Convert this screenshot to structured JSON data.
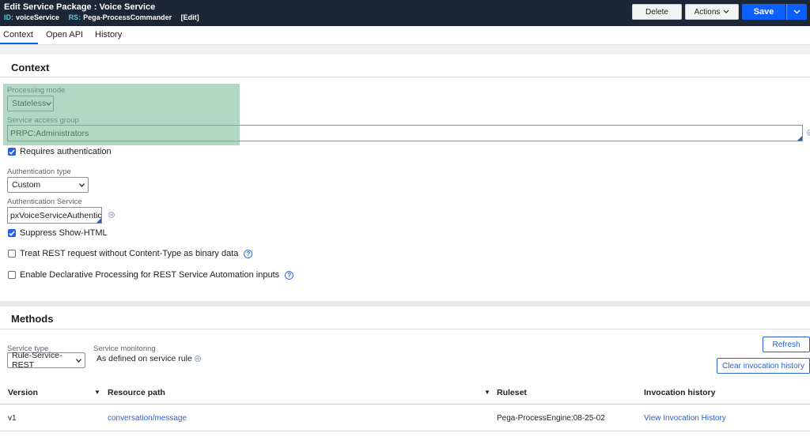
{
  "header": {
    "title": "Edit  Service Package : Voice Service",
    "id_label": "ID:",
    "id_value": "voiceService",
    "rs_label": "RS:",
    "rs_value": "Pega-ProcessCommander",
    "edit_label": "[Edit]",
    "delete_label": "Delete",
    "actions_label": "Actions",
    "save_label": "Save"
  },
  "tabs": [
    {
      "label": "Context"
    },
    {
      "label": "Open API"
    },
    {
      "label": "History"
    }
  ],
  "context": {
    "section_title": "Context",
    "processing_mode_label": "Processing mode",
    "processing_mode_value": "Stateless",
    "service_access_group_label": "Service access group",
    "service_access_group_value": "PRPC:Administrators",
    "requires_auth_label": "Requires authentication",
    "auth_type_label": "Authentication type",
    "auth_type_value": "Custom",
    "auth_service_label": "Authentication Service",
    "auth_service_value": "pxVoiceServiceAuthentica",
    "suppress_html_label": "Suppress Show-HTML",
    "treat_rest_label": "Treat REST request without Content-Type as binary data",
    "declarative_label": "Enable Declarative Processing for REST Service Automation inputs"
  },
  "methods": {
    "section_title": "Methods",
    "service_type_label": "Service type",
    "service_type_value": "Rule-Service-REST",
    "service_monitoring_label": "Service monitoring",
    "service_monitoring_value": "As defined on service rule",
    "refresh_label": "Refresh",
    "clear_history_label": "Clear invocation history",
    "columns": [
      "Version",
      "Resource path",
      "Ruleset",
      "Invocation history"
    ],
    "rows": [
      {
        "version": "v1",
        "resource_path": "conversation/message",
        "ruleset": "Pega-ProcessEngine:08-25-02",
        "invocation_history": "View Invocation History"
      }
    ]
  },
  "colors": {
    "header_bg": "#1b2637",
    "accent": "#0b5fff",
    "link": "#2c62d9",
    "highlight": "#73b896"
  }
}
